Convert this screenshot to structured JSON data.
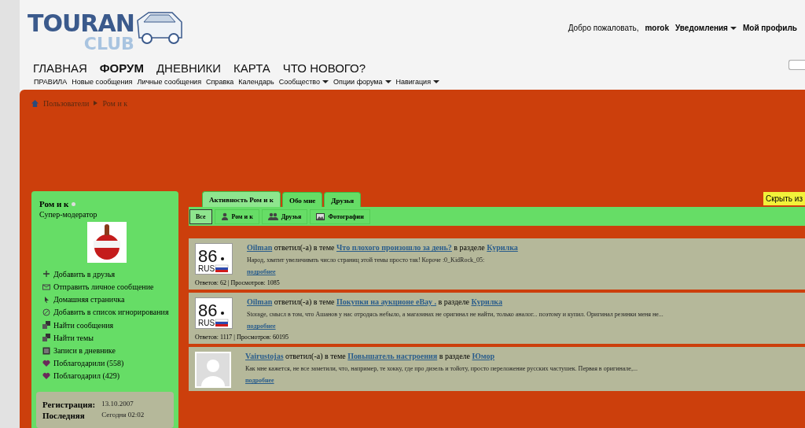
{
  "logo": {
    "line1": "TOURAN",
    "line2": "CLUB"
  },
  "user_links": [
    {
      "kind": "text",
      "label": "Добро пожаловать,"
    },
    {
      "kind": "user",
      "label": "morok"
    },
    {
      "kind": "menu",
      "label": "Уведомления"
    },
    {
      "kind": "link",
      "label": "Мой профиль"
    }
  ],
  "main_nav": [
    {
      "label": "ГЛАВНАЯ",
      "selected": false
    },
    {
      "label": "ФОРУМ",
      "selected": true
    },
    {
      "label": "ДНЕВНИКИ",
      "selected": false
    },
    {
      "label": "КАРТА",
      "selected": false
    },
    {
      "label": "ЧТО НОВОГО?",
      "selected": false
    }
  ],
  "sub_nav": [
    {
      "label": "ПРАВИЛА",
      "menu": false
    },
    {
      "label": "Новые сообщения",
      "menu": false
    },
    {
      "label": "Личные сообщения",
      "menu": false
    },
    {
      "label": "Справка",
      "menu": false
    },
    {
      "label": "Календарь",
      "menu": false
    },
    {
      "label": "Сообщество",
      "menu": true
    },
    {
      "label": "Опции форума",
      "menu": true
    },
    {
      "label": "Навигация",
      "menu": true
    }
  ],
  "breadcrumb": [
    "Пользователи",
    "Ром и к"
  ],
  "profile": {
    "name": "Ром и к",
    "online": false,
    "title": "Супер-модератор",
    "actions": [
      {
        "kind": "plus",
        "label": "Добавить в друзья"
      },
      {
        "kind": "mail",
        "label": "Отправить личное сообщение"
      },
      {
        "kind": "pointer",
        "label": "Домашняя страничка"
      },
      {
        "kind": "block",
        "label": "Добавить в список игнорирования"
      },
      {
        "kind": "search",
        "label": "Найти сообщения"
      },
      {
        "kind": "search",
        "label": "Найти темы"
      },
      {
        "kind": "blog",
        "label": "Записи в дневнике"
      },
      {
        "kind": "heart",
        "label": "Поблагодарили (558)"
      },
      {
        "kind": "heart",
        "label": "Поблагодарил (429)"
      }
    ],
    "stats": [
      {
        "label": "Регистрация:",
        "value": "13.10.2007"
      },
      {
        "label": "Последняя",
        "value": "Сегодня 02:02"
      }
    ]
  },
  "tabs": [
    {
      "label": "Активность Ром и к",
      "selected": true
    },
    {
      "label": "Обо мне",
      "selected": false
    },
    {
      "label": "Друзья",
      "selected": false
    }
  ],
  "hide_button": "Скрыть из",
  "filters": [
    {
      "kind": "all",
      "label": "Все",
      "selected": true
    },
    {
      "kind": "user",
      "label": "Ром и к",
      "selected": false
    },
    {
      "kind": "friends",
      "label": "Друзья",
      "selected": false
    },
    {
      "kind": "photos",
      "label": "Фотографии",
      "selected": false
    }
  ],
  "activity": [
    {
      "avatar": {
        "kind": "plate",
        "number": "86",
        "region": "RUS"
      },
      "user": "Oilman",
      "action": "ответил(-а) в теме",
      "topic": "Что плохого произошло за день?",
      "section_label": "в разделе",
      "section": "Курилка",
      "excerpt": "Народ, хватит увеличивать число страниц этой темы просто так! Короче :0_KidRock_05:",
      "more": "подробнее",
      "stats": "Ответов: 62 | Просмотров: 1085"
    },
    {
      "avatar": {
        "kind": "plate",
        "number": "86",
        "region": "RUS"
      },
      "user": "Oilman",
      "action": "ответил(-а) в теме",
      "topic": "Покупки на аукционе eBay .",
      "section_label": "в разделе",
      "section": "Курилка",
      "excerpt": "Storage, смысл в том, что Ашанов у нас отродясь небыло, а магазинах не оригинал не найти, только аналог... поэтому и купил. Оригинал резинки меня не...",
      "more": "подробнее",
      "stats": "Ответов: 1117 | Просмотров: 60195"
    },
    {
      "avatar": {
        "kind": "blank"
      },
      "user": "Vairustojas",
      "action": "ответил(-а) в теме",
      "topic": "Повышатель настроения",
      "section_label": "в разделе",
      "section": "Юмор",
      "excerpt": "Как мне кажется, не все заметили, что, например, те хокку, где про дизель и тойоту, просто переложение русских частушек. Первая в оригинале,...",
      "more": "подробнее"
    }
  ]
}
